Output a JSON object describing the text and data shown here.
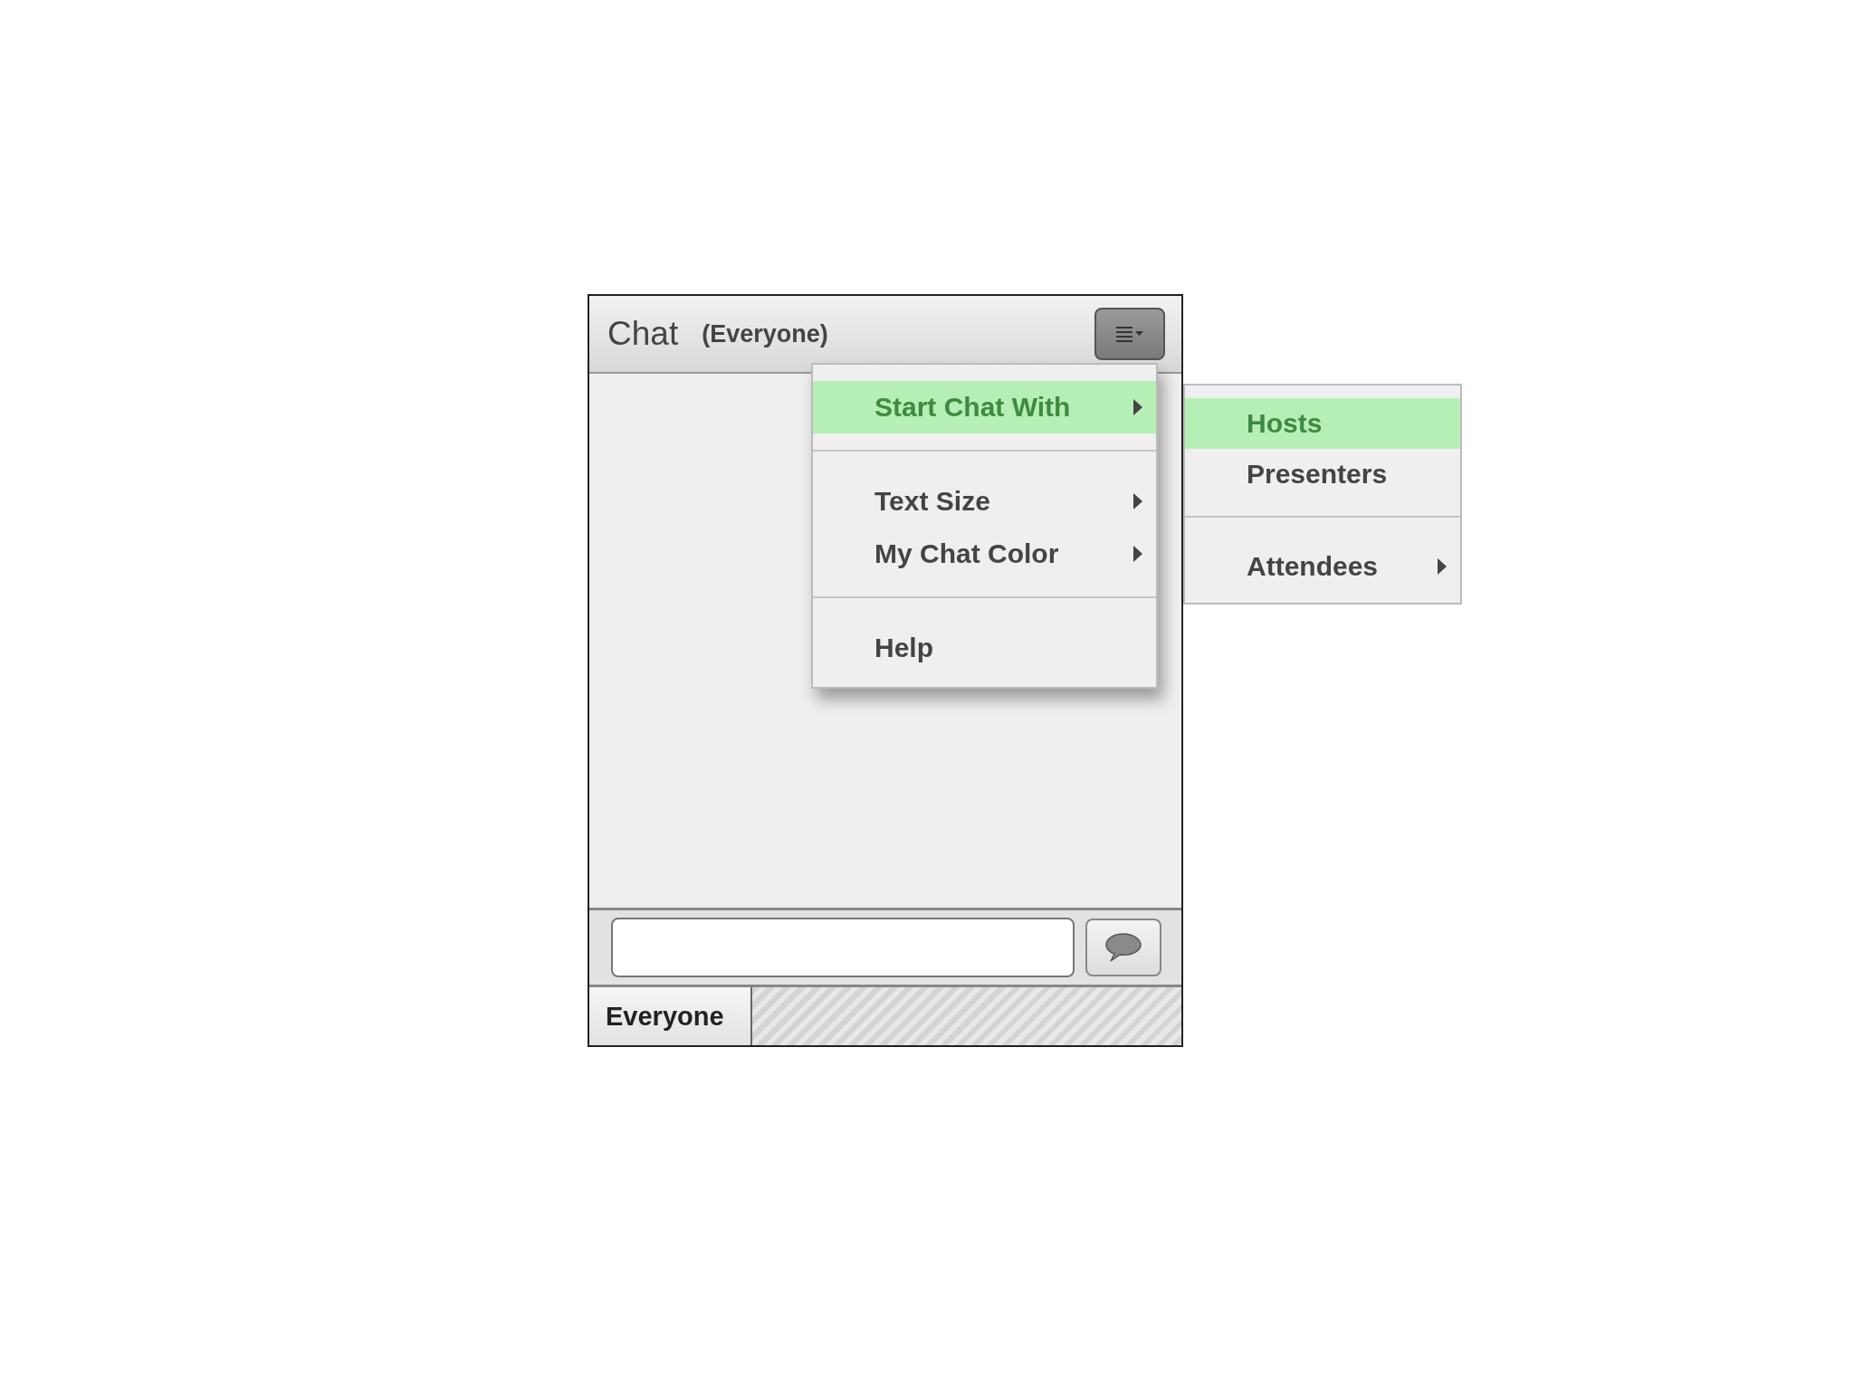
{
  "panel": {
    "title": "Chat",
    "subtitle": "(Everyone)"
  },
  "menu": {
    "groups": [
      [
        {
          "label": "Start Chat With",
          "selected": true,
          "has_submenu": true
        }
      ],
      [
        {
          "label": "Text Size",
          "selected": false,
          "has_submenu": true
        },
        {
          "label": "My Chat Color",
          "selected": false,
          "has_submenu": true
        }
      ],
      [
        {
          "label": "Help",
          "selected": false,
          "has_submenu": false
        }
      ]
    ]
  },
  "submenu": {
    "groups": [
      [
        {
          "label": "Hosts",
          "selected": true,
          "has_submenu": false
        },
        {
          "label": "Presenters",
          "selected": false,
          "has_submenu": false
        }
      ],
      [
        {
          "label": "Attendees",
          "selected": false,
          "has_submenu": true
        }
      ]
    ]
  },
  "tabs": [
    {
      "label": "Everyone",
      "selected": true
    }
  ]
}
